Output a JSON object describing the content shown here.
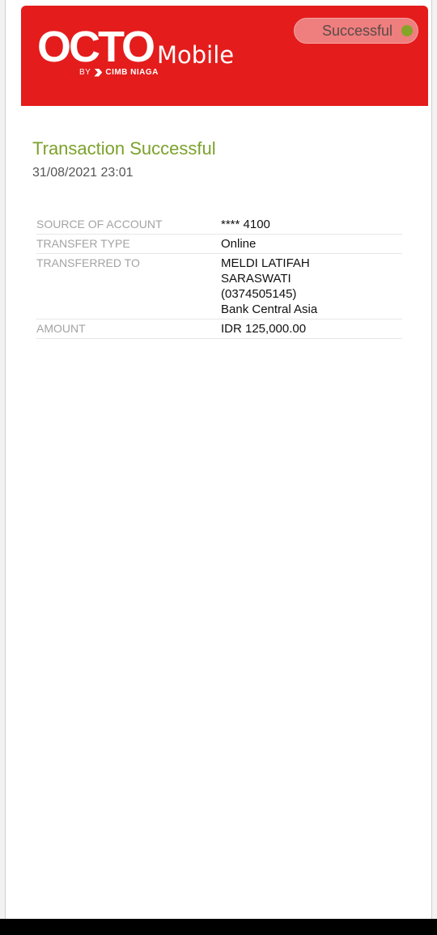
{
  "header": {
    "logo_main": "OCTO",
    "logo_sub": "Mobile",
    "logo_by": "BY",
    "logo_brand": "CIMB NIAGA",
    "status_label": "Successful",
    "colors": {
      "header_bg": "#e41c1c",
      "status_dot": "#84a527"
    }
  },
  "main": {
    "title": "Transaction Successful",
    "datetime": "31/08/2021 23:01",
    "title_color": "#7ca12b",
    "details": [
      {
        "label": "SOURCE OF ACCOUNT",
        "value": "**** 4100"
      },
      {
        "label": "TRANSFER TYPE",
        "value": "Online"
      },
      {
        "label": "TRANSFERRED TO",
        "value": "MELDI LATIFAH\nSARASWATI\n(0374505145)\nBank Central Asia"
      },
      {
        "label": "AMOUNT",
        "value": "IDR 125,000.00"
      }
    ]
  }
}
